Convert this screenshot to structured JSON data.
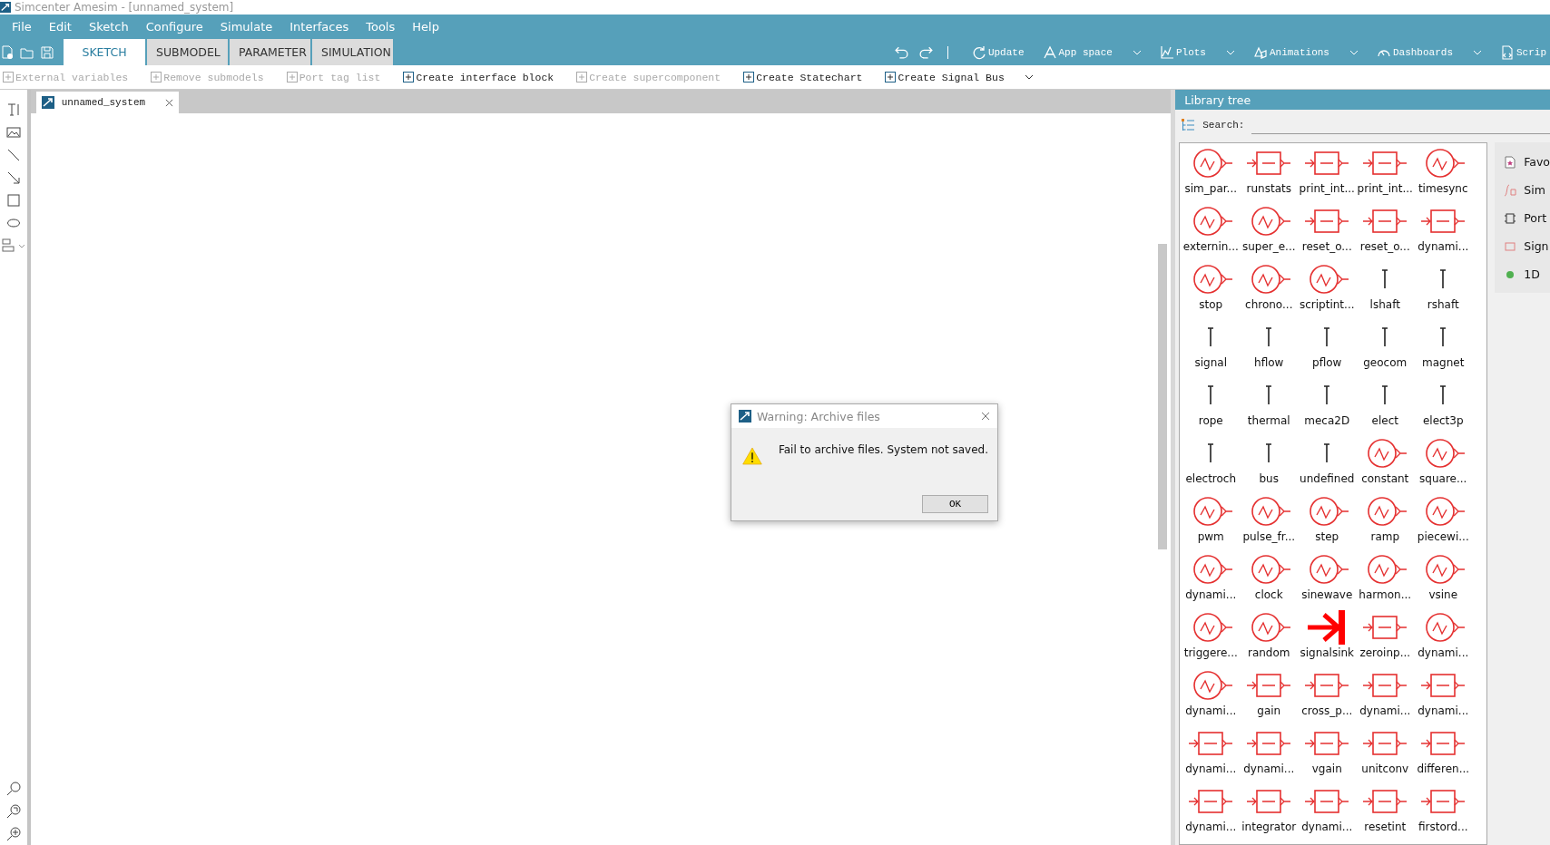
{
  "window": {
    "title": "Simcenter Amesim - [unnamed_system]"
  },
  "menu": [
    "File",
    "Edit",
    "Sketch",
    "Configure",
    "Simulate",
    "Interfaces",
    "Tools",
    "Help"
  ],
  "ribbon_tabs": [
    {
      "label": "SKETCH",
      "selected": true
    },
    {
      "label": "SUBMODEL",
      "selected": false
    },
    {
      "label": "PARAMETER",
      "selected": false
    },
    {
      "label": "SIMULATION",
      "selected": false
    }
  ],
  "ribbon_tools": [
    {
      "label": "Update",
      "kind": "update",
      "dropdown": false
    },
    {
      "label": "App space",
      "kind": "app",
      "dropdown": true
    },
    {
      "label": "Plots",
      "kind": "plot",
      "dropdown": true
    },
    {
      "label": "Animations",
      "kind": "anim",
      "dropdown": true
    },
    {
      "label": "Dashboards",
      "kind": "dash",
      "dropdown": true
    },
    {
      "label": "Scrip",
      "kind": "script",
      "dropdown": false
    }
  ],
  "toolbar": [
    {
      "label": "External variables",
      "disabled": true
    },
    {
      "label": "Remove submodels",
      "disabled": true
    },
    {
      "label": "Port tag list",
      "disabled": true
    },
    {
      "label": "Create interface block",
      "disabled": false
    },
    {
      "label": "Create supercomponent",
      "disabled": true
    },
    {
      "label": "Create Statechart",
      "disabled": false
    },
    {
      "label": "Create Signal Bus",
      "disabled": false
    }
  ],
  "document_tab": {
    "title": "unnamed_system"
  },
  "library": {
    "title": "Library tree",
    "search_label": "Search:",
    "items": [
      {
        "label": "sim_par...",
        "kind": "circle"
      },
      {
        "label": "runstats",
        "kind": "box"
      },
      {
        "label": "print_int...",
        "kind": "box"
      },
      {
        "label": "print_int...",
        "kind": "box"
      },
      {
        "label": "timesync",
        "kind": "circle"
      },
      {
        "label": "externin...",
        "kind": "circle"
      },
      {
        "label": "super_e...",
        "kind": "circle"
      },
      {
        "label": "reset_o...",
        "kind": "box"
      },
      {
        "label": "reset_o...",
        "kind": "box"
      },
      {
        "label": "dynami...",
        "kind": "box"
      },
      {
        "label": "stop",
        "kind": "circle"
      },
      {
        "label": "chrono...",
        "kind": "circle"
      },
      {
        "label": "scriptint...",
        "kind": "circle"
      },
      {
        "label": "lshaft",
        "kind": "port"
      },
      {
        "label": "rshaft",
        "kind": "port"
      },
      {
        "label": "signal",
        "kind": "port"
      },
      {
        "label": "hflow",
        "kind": "port"
      },
      {
        "label": "pflow",
        "kind": "port"
      },
      {
        "label": "geocom",
        "kind": "port"
      },
      {
        "label": "magnet",
        "kind": "port"
      },
      {
        "label": "rope",
        "kind": "port"
      },
      {
        "label": "thermal",
        "kind": "port"
      },
      {
        "label": "meca2D",
        "kind": "port"
      },
      {
        "label": "elect",
        "kind": "port"
      },
      {
        "label": "elect3p",
        "kind": "port"
      },
      {
        "label": "electroch",
        "kind": "port"
      },
      {
        "label": "bus",
        "kind": "port"
      },
      {
        "label": "undefined",
        "kind": "port"
      },
      {
        "label": "constant",
        "kind": "circle"
      },
      {
        "label": "square...",
        "kind": "circle"
      },
      {
        "label": "pwm",
        "kind": "circle"
      },
      {
        "label": "pulse_fr...",
        "kind": "circle"
      },
      {
        "label": "step",
        "kind": "circle"
      },
      {
        "label": "ramp",
        "kind": "circle"
      },
      {
        "label": "piecewi...",
        "kind": "circle"
      },
      {
        "label": "dynami...",
        "kind": "circle"
      },
      {
        "label": "clock",
        "kind": "circle"
      },
      {
        "label": "sinewave",
        "kind": "circle"
      },
      {
        "label": "harmon...",
        "kind": "circle"
      },
      {
        "label": "vsine",
        "kind": "circle"
      },
      {
        "label": "triggere...",
        "kind": "circle"
      },
      {
        "label": "random",
        "kind": "circle"
      },
      {
        "label": "signalsink",
        "kind": "sink"
      },
      {
        "label": "zeroinp...",
        "kind": "box"
      },
      {
        "label": "dynami...",
        "kind": "circle"
      },
      {
        "label": "dynami...",
        "kind": "circle"
      },
      {
        "label": "gain",
        "kind": "box"
      },
      {
        "label": "cross_p...",
        "kind": "box"
      },
      {
        "label": "dynami...",
        "kind": "box"
      },
      {
        "label": "dynami...",
        "kind": "box"
      },
      {
        "label": "dynami...",
        "kind": "box"
      },
      {
        "label": "dynami...",
        "kind": "box"
      },
      {
        "label": "vgain",
        "kind": "box"
      },
      {
        "label": "unitconv",
        "kind": "box"
      },
      {
        "label": "differen...",
        "kind": "box"
      },
      {
        "label": "dynami...",
        "kind": "box"
      },
      {
        "label": "integrator",
        "kind": "box"
      },
      {
        "label": "dynami...",
        "kind": "box"
      },
      {
        "label": "resetint",
        "kind": "box"
      },
      {
        "label": "firstord...",
        "kind": "box"
      }
    ],
    "categories": [
      "Favo",
      "Sim",
      "Port",
      "Sign",
      "1D"
    ]
  },
  "dialog": {
    "title": "Warning: Archive files",
    "message": "Fail to archive files. System not saved.",
    "button": "OK"
  }
}
